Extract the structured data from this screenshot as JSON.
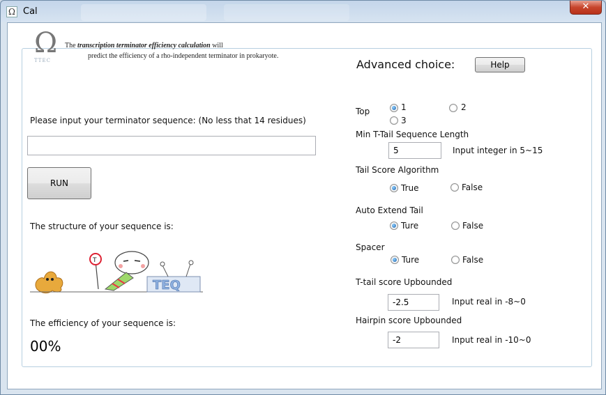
{
  "window": {
    "title": "Cal",
    "app_icon": "omega-icon",
    "close_label": "✕"
  },
  "header": {
    "logo_text": "TTEC",
    "line1_prefix": "The",
    "line1_bold": "transcription terminator efficiency calculation",
    "line1_suffix": "will",
    "line2": "predict the efficiency of  a rho-independent terminator in prokaryote."
  },
  "left": {
    "sequence_prompt": "Please input your terminator sequence: (No less that 14 residues)",
    "sequence_value": "",
    "run_label": "RUN",
    "structure_label": "The structure of your sequence is:",
    "efficiency_label": "The efficiency of your sequence is:",
    "efficiency_value": "00%"
  },
  "right": {
    "advanced_label": "Advanced choice:",
    "help_label": "Help",
    "top": {
      "label": "Top",
      "options": [
        "1",
        "2",
        "3"
      ],
      "selected": "1"
    },
    "min_tail": {
      "label": "Min T-Tail Sequence Length",
      "value": "5",
      "hint": "Input integer in 5~15"
    },
    "tail_score": {
      "label": "Tail Score Algorithm",
      "opt_true": "True",
      "opt_false": "False",
      "selected": "True"
    },
    "auto_extend": {
      "label": "Auto Extend Tail",
      "opt_true": "Ture",
      "opt_false": "False",
      "selected": "Ture"
    },
    "spacer": {
      "label": "Spacer",
      "opt_true": "Ture",
      "opt_false": "False",
      "selected": "Ture"
    },
    "ttail_upbound": {
      "label": "T-tail score Upbounded",
      "value": "-2.5",
      "hint": "Input real in -8~0"
    },
    "hairpin_upbound": {
      "label": "Hairpin score Upbounded",
      "value": "-2",
      "hint": "Input real in -10~0"
    }
  },
  "colors": {
    "radio_selected": "#1a5fa8",
    "close_button": "#c7452c",
    "group_border": "#b7cfe0"
  }
}
